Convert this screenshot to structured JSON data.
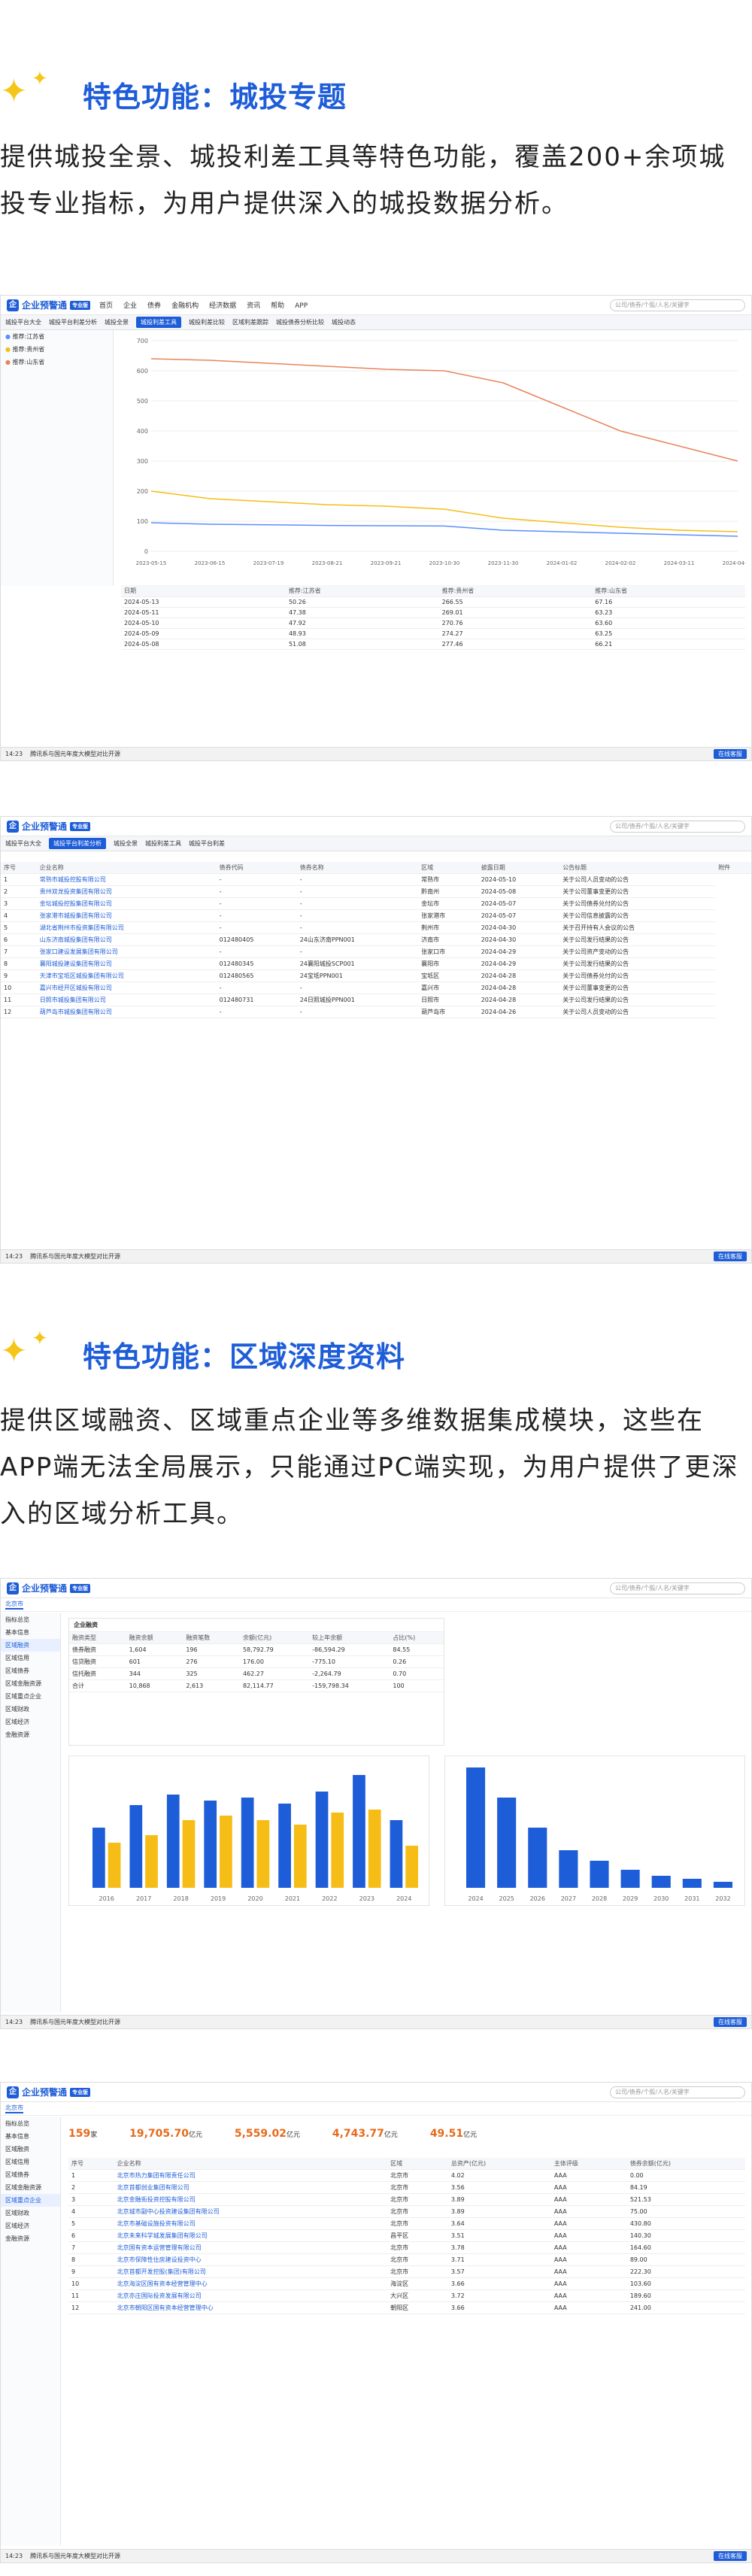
{
  "sections": [
    {
      "title": "特色功能：城投专题",
      "desc": "提供城投全景、城投利差工具等特色功能，覆盖200+余项城投专业指标，为用户提供深入的城投数据分析。"
    },
    {
      "title": "特色功能：区域深度资料",
      "desc": "提供区域融资、区域重点企业等多维数据集成模块，这些在APP端无法全局展示，只能通过PC端实现，为用户提供了更深入的区域分析工具。"
    }
  ],
  "app": {
    "name": "企业预警通",
    "tag": "专业版",
    "nav": [
      "首页",
      "企业",
      "债券",
      "金融机构",
      "经济数据",
      "资讯",
      "帮助",
      "APP"
    ],
    "search_placeholder": "公司/债券/个股/人名/关键字",
    "status_time": "14:23",
    "status_text": "腾讯系与国元年度大模型对比开源",
    "status_btn": "在线客服"
  },
  "shot1": {
    "tabs": [
      "城投平台大全",
      "城投平台利差分析",
      "城投全景",
      "城投利差工具",
      "城投利差比较",
      "区域利差跟踪",
      "城投债券分析比较",
      "城投动态"
    ],
    "active_tab": "城投利差工具",
    "legend": [
      "推荐:江苏省",
      "推荐:贵州省",
      "推荐:山东省"
    ],
    "colors": {
      "s1": "#5b8ff9",
      "s2": "#f6bd16",
      "s3": "#e8845c"
    },
    "chart_data": {
      "type": "line",
      "x": [
        "2023-05-15",
        "2023-06-15",
        "2023-07-19",
        "2023-08-21",
        "2023-09-21",
        "2023-10-30",
        "2023-11-30",
        "2024-01-02",
        "2024-02-02",
        "2024-03-11",
        "2024-04-12"
      ],
      "ylim": [
        0,
        700
      ],
      "yticks": [
        0,
        100,
        200,
        300,
        400,
        500,
        600,
        700
      ],
      "series": [
        {
          "name": "推荐:江苏省",
          "values": [
            95,
            90,
            88,
            86,
            85,
            84,
            70,
            65,
            60,
            55,
            50
          ]
        },
        {
          "name": "推荐:贵州省",
          "values": [
            200,
            175,
            165,
            155,
            150,
            140,
            110,
            95,
            80,
            70,
            65
          ]
        },
        {
          "name": "推荐:山东省",
          "values": [
            640,
            635,
            625,
            615,
            605,
            600,
            560,
            480,
            400,
            350,
            300
          ]
        }
      ]
    },
    "table_headers": [
      "日期",
      "推荐:江苏省",
      "推荐:贵州省",
      "推荐:山东省"
    ],
    "rows": [
      [
        "2024-05-13",
        "50.26",
        "266.55",
        "67.16"
      ],
      [
        "2024-05-11",
        "47.38",
        "269.01",
        "63.23"
      ],
      [
        "2024-05-10",
        "47.92",
        "270.76",
        "63.60"
      ],
      [
        "2024-05-09",
        "48.93",
        "274.27",
        "63.25"
      ],
      [
        "2024-05-08",
        "51.08",
        "277.46",
        "66.21"
      ]
    ]
  },
  "shot2": {
    "tabs": [
      "城投平台大全",
      "城投平台利差分析",
      "城投全景",
      "城投利差工具",
      "城投平台利差"
    ],
    "headers": [
      "序号",
      "企业名称",
      "债券代码",
      "债券名称",
      "区域",
      "披露日期",
      "公告标题",
      "附件"
    ],
    "rows": [
      [
        "1",
        "常熟市城投控股有限公司",
        "-",
        "-",
        "常熟市",
        "2024-05-10",
        "关于公司人员变动的公告"
      ],
      [
        "2",
        "贵州双龙投资集团有限公司",
        "-",
        "-",
        "黔南州",
        "2024-05-08",
        "关于公司董事变更的公告"
      ],
      [
        "3",
        "金坛城投控股集团有限公司",
        "-",
        "-",
        "金坛市",
        "2024-05-07",
        "关于公司债券兑付的公告"
      ],
      [
        "4",
        "张家港市城投集团有限公司",
        "-",
        "-",
        "张家港市",
        "2024-05-07",
        "关于公司信息披露的公告"
      ],
      [
        "5",
        "湖北省荆州市投资集团有限公司",
        "-",
        "-",
        "荆州市",
        "2024-04-30",
        "关于召开持有人会议的公告"
      ],
      [
        "6",
        "山东济南城投集团有限公司",
        "012480405",
        "24山东济南PPN001",
        "济南市",
        "2024-04-30",
        "关于公司发行结果的公告"
      ],
      [
        "7",
        "张家口建设发展集团有限公司",
        "-",
        "-",
        "张家口市",
        "2024-04-29",
        "关于公司资产变动的公告"
      ],
      [
        "8",
        "襄阳城投建设集团有限公司",
        "012480345",
        "24襄阳城投SCP001",
        "襄阳市",
        "2024-04-29",
        "关于公司发行结果的公告"
      ],
      [
        "9",
        "天津市宝坻区城投集团有限公司",
        "012480565",
        "24宝坻PPN001",
        "宝坻区",
        "2024-04-28",
        "关于公司债券兑付的公告"
      ],
      [
        "10",
        "嘉兴市经开区城投有限公司",
        "-",
        "-",
        "嘉兴市",
        "2024-04-28",
        "关于公司董事变更的公告"
      ],
      [
        "11",
        "日照市城投集团有限公司",
        "012480731",
        "24日照城投PPN001",
        "日照市",
        "2024-04-28",
        "关于公司发行结果的公告"
      ],
      [
        "12",
        "葫芦岛市城投集团有限公司",
        "-",
        "-",
        "葫芦岛市",
        "2024-04-26",
        "关于公司人员变动的公告"
      ]
    ]
  },
  "shot3": {
    "region": "北京市",
    "side": [
      "指标总览",
      "基本信息",
      "区域融资",
      "区域信用",
      "区域债券",
      "区域金融资源",
      "区域重点企业",
      "区域财政",
      "区域经济",
      "金融资源"
    ],
    "fin_title": "企业融资",
    "fin_headers": [
      "融资类型",
      "融资余额",
      "融资笔数",
      "余额(亿元)",
      "较上年余额",
      "占比(%)"
    ],
    "fin_rows": [
      [
        "债券融资",
        "1,604",
        "196",
        "58,792.79",
        "-86,594.29",
        "84.55"
      ],
      [
        "信贷融资",
        "601",
        "276",
        "176.00",
        "-775.10",
        "0.26"
      ],
      [
        "信托融资",
        "344",
        "325",
        "462.27",
        "-2,264.79",
        "0.70"
      ],
      [
        "合计",
        "10,868",
        "2,613",
        "82,114.77",
        "-159,798.34",
        "100"
      ]
    ],
    "chart_data": [
      {
        "type": "bar",
        "categories": [
          "2016",
          "2017",
          "2018",
          "2019",
          "2020",
          "2021",
          "2022",
          "2023",
          "2024"
        ],
        "series": [
          {
            "name": "发行规模",
            "values": [
              40,
              55,
              62,
              58,
              60,
              56,
              64,
              75,
              45
            ]
          },
          {
            "name": "偿还规模",
            "values": [
              30,
              35,
              45,
              48,
              45,
              42,
              50,
              52,
              28
            ]
          }
        ]
      },
      {
        "type": "bar",
        "categories": [
          "2024",
          "2025",
          "2026",
          "2027",
          "2028",
          "2029",
          "2030",
          "2031",
          "2032"
        ],
        "values": [
          80,
          60,
          40,
          25,
          18,
          12,
          8,
          6,
          4
        ]
      }
    ]
  },
  "shot4": {
    "region": "北京市",
    "stats": [
      {
        "v": "159",
        "u": "家"
      },
      {
        "v": "19,705.70",
        "u": "亿元"
      },
      {
        "v": "5,559.02",
        "u": "亿元"
      },
      {
        "v": "4,743.77",
        "u": "亿元"
      },
      {
        "v": "49.51",
        "u": "亿元"
      }
    ],
    "headers": [
      "序号",
      "企业名称",
      "区域",
      "总资产(亿元)",
      "主体评级",
      "债券余额(亿元)"
    ],
    "rows": [
      [
        "1",
        "北京市热力集团有限责任公司",
        "北京市",
        "4.02",
        "AAA",
        "0.00"
      ],
      [
        "2",
        "北京首都创业集团有限公司",
        "北京市",
        "3.56",
        "AAA",
        "84.19"
      ],
      [
        "3",
        "北京金融街投资控股有限公司",
        "北京市",
        "3.89",
        "AAA",
        "521.53"
      ],
      [
        "4",
        "北京城市副中心投资建设集团有限公司",
        "北京市",
        "3.89",
        "AAA",
        "75.00"
      ],
      [
        "5",
        "北京市基础设施投资有限公司",
        "北京市",
        "3.64",
        "AAA",
        "430.80"
      ],
      [
        "6",
        "北京未来科学城发展集团有限公司",
        "昌平区",
        "3.51",
        "AAA",
        "140.30"
      ],
      [
        "7",
        "北京国有资本运营管理有限公司",
        "北京市",
        "3.78",
        "AAA",
        "164.60"
      ],
      [
        "8",
        "北京市保障性住房建设投资中心",
        "北京市",
        "3.71",
        "AAA",
        "89.00"
      ],
      [
        "9",
        "北京首都开发控股(集团)有限公司",
        "北京市",
        "3.57",
        "AAA",
        "222.30"
      ],
      [
        "10",
        "北京海淀区国有资本经营管理中心",
        "海淀区",
        "3.66",
        "AAA",
        "103.60"
      ],
      [
        "11",
        "北京亦庄国际投资发展有限公司",
        "大兴区",
        "3.72",
        "AAA",
        "189.60"
      ],
      [
        "12",
        "北京市朝阳区国有资本经营管理中心",
        "朝阳区",
        "3.66",
        "AAA",
        "241.00"
      ]
    ]
  }
}
